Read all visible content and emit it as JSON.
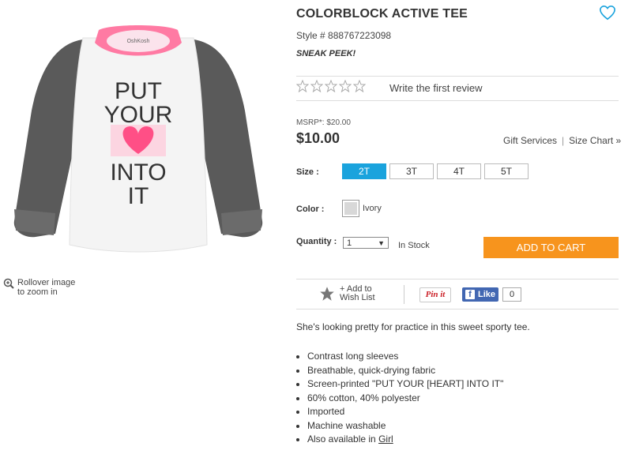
{
  "product": {
    "title": "COLORBLOCK ACTIVE TEE",
    "style_line": "Style # 888767223098",
    "badge": "SNEAK PEEK!",
    "image_print_text": [
      "PUT",
      "YOUR",
      "INTO",
      "IT"
    ],
    "zoom_hint": [
      "Rollover image",
      "to zoom in"
    ]
  },
  "reviews": {
    "rating": 0,
    "max": 5,
    "link_label": "Write the first review"
  },
  "pricing": {
    "msrp": "MSRP*: $20.00",
    "price": "$10.00"
  },
  "links": {
    "gift_services": "Gift Services",
    "separator": "|",
    "size_chart": "Size Chart »"
  },
  "options": {
    "size_label": "Size :",
    "sizes": [
      "2T",
      "3T",
      "4T",
      "5T"
    ],
    "selected_size": "2T",
    "color_label": "Color :",
    "color_name": "Ivory",
    "quantity_label": "Quantity :",
    "quantity": "1",
    "stock": "In Stock",
    "add_to_cart": "ADD TO CART"
  },
  "share": {
    "wishlist": "+ Add to Wish List",
    "pinit": "Pin it",
    "fb_like": "Like",
    "fb_count": "0"
  },
  "description": {
    "intro": "She's looking pretty for practice in this sweet sporty tee.",
    "bullets": [
      "Contrast long sleeves",
      "Breathable, quick-drying fabric",
      "Screen-printed \"PUT YOUR [HEART] INTO IT\"",
      "60% cotton, 40% polyester",
      "Imported",
      "Machine washable"
    ],
    "also_available_prefix": "Also available in ",
    "also_available_link": "Girl"
  },
  "colors": {
    "accent_blue": "#1aa3dd",
    "cta_orange": "#f7941d",
    "neon_pink": "#ff4f86"
  }
}
